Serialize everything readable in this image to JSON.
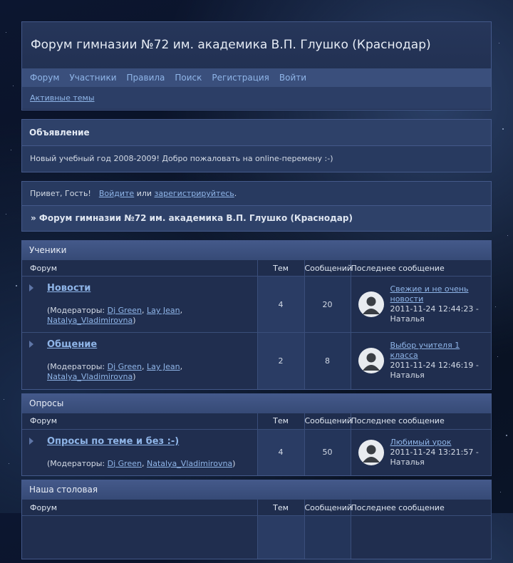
{
  "header": {
    "title": "Форум гимназии №72 им. академика В.П. Глушко (Краснодар)"
  },
  "nav": [
    "Форум",
    "Участники",
    "Правила",
    "Поиск",
    "Регистрация",
    "Войти"
  ],
  "subnav": {
    "active_topics": "Активные темы"
  },
  "announcement": {
    "title": "Объявление",
    "text": "Новый учебный год 2008-2009! Добро пожаловать на online-перемену :-)"
  },
  "welcome": {
    "greeting": "Привет, Гость!",
    "login": "Войдите",
    "or": "или",
    "register": "зарегистрируйтесь",
    "period": "."
  },
  "breadcrumb": "» Форум гимназии №72 им. академика В.П. Глушко (Краснодар)",
  "columns": {
    "forum": "Форум",
    "topics": "Тем",
    "posts": "Сообщений",
    "last": "Последнее сообщение"
  },
  "categories": [
    {
      "name": "Ученики",
      "forums": [
        {
          "title": "Новости",
          "mods_prefix": "(Модераторы:",
          "mods": [
            "Dj Green",
            "Lay Jean",
            "Natalya_Vladimirovna"
          ],
          "topics": "4",
          "posts": "20",
          "last_title": "Свежие и не очень новости",
          "last_date": "2011-11-24 12:44:23 -",
          "last_user": "Наталья"
        },
        {
          "title": "Общение",
          "mods_prefix": "(Модераторы:",
          "mods": [
            "Dj Green",
            "Lay Jean",
            "Natalya_Vladimirovna"
          ],
          "topics": "2",
          "posts": "8",
          "last_title": "Выбор учителя 1 класса",
          "last_date": "2011-11-24 12:46:19 -",
          "last_user": "Наталья"
        }
      ]
    },
    {
      "name": "Опросы",
      "forums": [
        {
          "title": "Опросы по теме и без :-)",
          "mods_prefix": "(Модераторы:",
          "mods": [
            "Dj Green",
            "Natalya_Vladimirovna"
          ],
          "topics": "4",
          "posts": "50",
          "last_title": "Любимый урок",
          "last_date": "2011-11-24 13:21:57 -",
          "last_user": "Наталья"
        }
      ]
    },
    {
      "name": "Наша столовая",
      "forums": []
    }
  ]
}
